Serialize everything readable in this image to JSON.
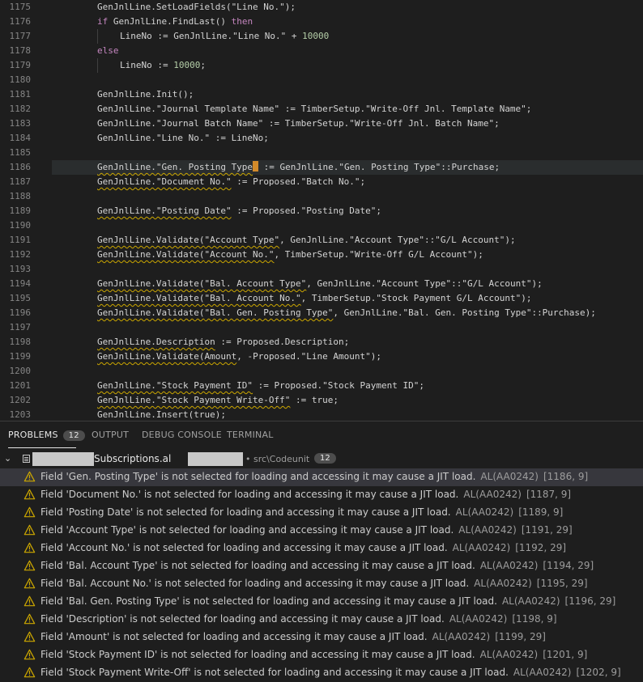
{
  "editor": {
    "lines": [
      {
        "n": "1175",
        "t": "GenJnlLine.SetLoadFields(\"Line No.\");",
        "kind": "plain"
      },
      {
        "n": "1176",
        "kw1": "if",
        "t": " GenJnlLine.FindLast()",
        "kw2": " then",
        "kind": "if"
      },
      {
        "n": "1177",
        "t": "LineNo := GenJnlLine.\"Line No.\" + ",
        "num": "10000",
        "kind": "indent"
      },
      {
        "n": "1178",
        "kw1": "else",
        "kind": "kw"
      },
      {
        "n": "1179",
        "t": "LineNo := ",
        "num": "10000",
        "tail": ";",
        "kind": "indent"
      },
      {
        "n": "1180",
        "t": "",
        "kind": "plain"
      },
      {
        "n": "1181",
        "t": "GenJnlLine.Init();",
        "kind": "plain"
      },
      {
        "n": "1182",
        "t": "GenJnlLine.\"Journal Template Name\" := TimberSetup.\"Write-Off Jnl. Template Name\";",
        "kind": "plain"
      },
      {
        "n": "1183",
        "t": "GenJnlLine.\"Journal Batch Name\" := TimberSetup.\"Write-Off Jnl. Batch Name\";",
        "kind": "plain"
      },
      {
        "n": "1184",
        "t": "GenJnlLine.\"Line No.\" := LineNo;",
        "kind": "plain"
      },
      {
        "n": "1185",
        "t": "",
        "kind": "plain"
      },
      {
        "n": "1186",
        "a": "GenJnlLine.\"Gen. Posting Type",
        "b": " := GenJnlLine.\"Gen. Posting Type\"::Purchase;",
        "kind": "cursor"
      },
      {
        "n": "1187",
        "a": "GenJnlLine.\"Document No.\"",
        "b": " := Proposed.\"Batch No.\";",
        "kind": "squig"
      },
      {
        "n": "1188",
        "t": "",
        "kind": "plain"
      },
      {
        "n": "1189",
        "a": "GenJnlLine.\"Posting Date\"",
        "b": " := Proposed.\"Posting Date\";",
        "kind": "squig"
      },
      {
        "n": "1190",
        "t": "",
        "kind": "plain"
      },
      {
        "n": "1191",
        "pre": "GenJnlLine.Validate(",
        "a": "\"Account Type\"",
        "b": ", GenJnlLine.\"Account Type\"::\"G/L Account\");",
        "kind": "val"
      },
      {
        "n": "1192",
        "pre": "GenJnlLine.Validate(",
        "a": "\"Account No.\"",
        "b": ", TimberSetup.\"Write-Off G/L Account\");",
        "kind": "val"
      },
      {
        "n": "1193",
        "t": "",
        "kind": "plain"
      },
      {
        "n": "1194",
        "pre": "GenJnlLine.Validate(",
        "a": "\"Bal. Account Type\"",
        "b": ", GenJnlLine.\"Account Type\"::\"G/L Account\");",
        "kind": "val"
      },
      {
        "n": "1195",
        "pre": "GenJnlLine.Validate(",
        "a": "\"Bal. Account No.\"",
        "b": ", TimberSetup.\"Stock Payment G/L Account\");",
        "kind": "val"
      },
      {
        "n": "1196",
        "pre": "GenJnlLine.Validate(",
        "a": "\"Bal. Gen. Posting Type\"",
        "b": ", GenJnlLine.\"Bal. Gen. Posting Type\"::Purchase);",
        "kind": "val"
      },
      {
        "n": "1197",
        "t": "",
        "kind": "plain"
      },
      {
        "n": "1198",
        "pre": "GenJnlLine.",
        "a": "Description",
        "b": " := Proposed.Description;",
        "kind": "val"
      },
      {
        "n": "1199",
        "pre": "GenJnlLine.Validate(",
        "a": "Amount",
        "b": ", -Proposed.\"Line Amount\");",
        "kind": "val"
      },
      {
        "n": "1200",
        "t": "",
        "kind": "plain"
      },
      {
        "n": "1201",
        "a": "GenJnlLine.\"Stock Payment ID\"",
        "b": " := Proposed.\"Stock Payment ID\";",
        "kind": "squig"
      },
      {
        "n": "1202",
        "a": "GenJnlLine.\"Stock Payment Write-Off\"",
        "b": " := true;",
        "kind": "squig"
      },
      {
        "n": "1203",
        "t": "GenJnlLine.Insert(true);",
        "kind": "plain"
      }
    ]
  },
  "panel": {
    "tabs": {
      "problems": "PROBLEMS",
      "problems_count": "12",
      "output": "OUTPUT",
      "debug": "DEBUG CONSOLE",
      "terminal": "TERMINAL"
    },
    "file": {
      "name": "Subscriptions.al",
      "path": "src\\Codeunit",
      "count": "12"
    },
    "problems": [
      {
        "msg": "Field 'Gen. Posting Type' is not selected for loading and accessing it may cause a JIT load.",
        "src": "AL(AA0242)",
        "pos": "[1186, 9]"
      },
      {
        "msg": "Field 'Document No.' is not selected for loading and accessing it may cause a JIT load.",
        "src": "AL(AA0242)",
        "pos": "[1187, 9]"
      },
      {
        "msg": "Field 'Posting Date' is not selected for loading and accessing it may cause a JIT load.",
        "src": "AL(AA0242)",
        "pos": "[1189, 9]"
      },
      {
        "msg": "Field 'Account Type' is not selected for loading and accessing it may cause a JIT load.",
        "src": "AL(AA0242)",
        "pos": "[1191, 29]"
      },
      {
        "msg": "Field 'Account No.' is not selected for loading and accessing it may cause a JIT load.",
        "src": "AL(AA0242)",
        "pos": "[1192, 29]"
      },
      {
        "msg": "Field 'Bal. Account Type' is not selected for loading and accessing it may cause a JIT load.",
        "src": "AL(AA0242)",
        "pos": "[1194, 29]"
      },
      {
        "msg": "Field 'Bal. Account No.' is not selected for loading and accessing it may cause a JIT load.",
        "src": "AL(AA0242)",
        "pos": "[1195, 29]"
      },
      {
        "msg": "Field 'Bal. Gen. Posting Type' is not selected for loading and accessing it may cause a JIT load.",
        "src": "AL(AA0242)",
        "pos": "[1196, 29]"
      },
      {
        "msg": "Field 'Description' is not selected for loading and accessing it may cause a JIT load.",
        "src": "AL(AA0242)",
        "pos": "[1198, 9]"
      },
      {
        "msg": "Field 'Amount' is not selected for loading and accessing it may cause a JIT load.",
        "src": "AL(AA0242)",
        "pos": "[1199, 29]"
      },
      {
        "msg": "Field 'Stock Payment ID' is not selected for loading and accessing it may cause a JIT load.",
        "src": "AL(AA0242)",
        "pos": "[1201, 9]"
      },
      {
        "msg": "Field 'Stock Payment Write-Off' is not selected for loading and accessing it may cause a JIT load.",
        "src": "AL(AA0242)",
        "pos": "[1202, 9]"
      }
    ]
  }
}
